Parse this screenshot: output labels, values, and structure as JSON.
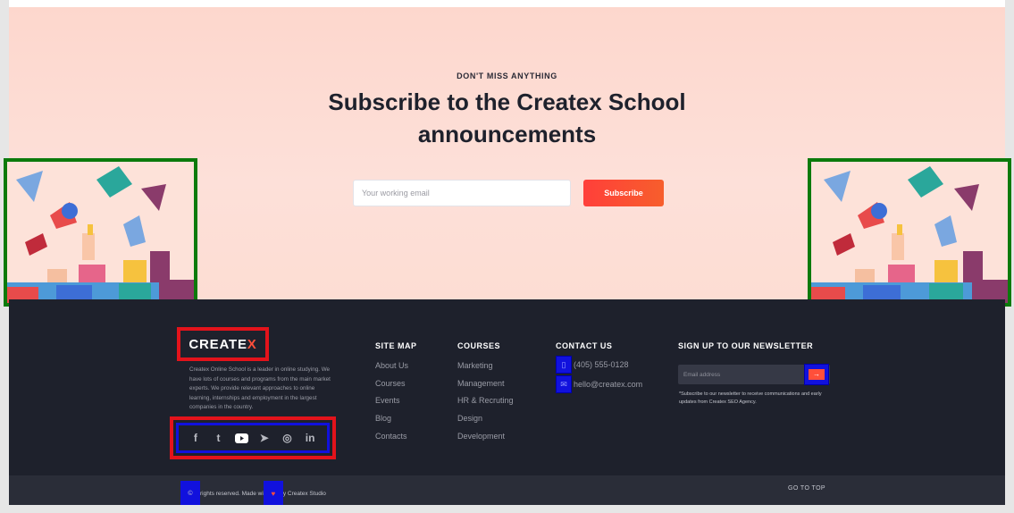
{
  "subscribe": {
    "eyebrow": "DON'T MISS ANYTHING",
    "headline_line1": "Subscribe to the Createx School",
    "headline_line2": "announcements",
    "email_placeholder": "Your working email",
    "button_label": "Subscribe"
  },
  "footer": {
    "logo_main": "CREATE",
    "logo_x": "X",
    "about": "Createx Online School is a leader in online studying. We have lots of courses and programs from the main market experts. We provide relevant approaches to online learning, internships and employment in the largest companies in the country.",
    "social": [
      {
        "icon": "facebook-icon",
        "glyph": "f"
      },
      {
        "icon": "twitter-icon",
        "glyph": "t"
      },
      {
        "icon": "youtube-icon",
        "glyph": "▶"
      },
      {
        "icon": "telegram-icon",
        "glyph": "➤"
      },
      {
        "icon": "instagram-icon",
        "glyph": "◎"
      },
      {
        "icon": "linkedin-icon",
        "glyph": "in"
      }
    ],
    "sitemap": {
      "title": "SITE MAP",
      "links": [
        "About Us",
        "Courses",
        "Events",
        "Blog",
        "Contacts"
      ]
    },
    "courses": {
      "title": "COURSES",
      "links": [
        "Marketing",
        "Management",
        "HR & Recruting",
        "Design",
        "Development"
      ]
    },
    "contact": {
      "title": "CONTACT US",
      "phone": "(405) 555-0128",
      "email": "hello@createx.com"
    },
    "newsletter": {
      "title": "SIGN UP TO OUR NEWSLETTER",
      "placeholder": "Email address",
      "note": "*Subscribe to our newsletter to receive communications and early updates from Createx SEO Agency."
    }
  },
  "bottombar": {
    "copyright_text": "rights reserved. Made wi",
    "made_by": "y Createx Studio",
    "go_top": "GO TO TOP"
  },
  "colors": {
    "accent": "#ff4f3a",
    "footer_bg": "#1e212c",
    "annotation_red": "#e3131b",
    "annotation_blue": "#1111dd",
    "annotation_green": "#0b7a0b"
  }
}
